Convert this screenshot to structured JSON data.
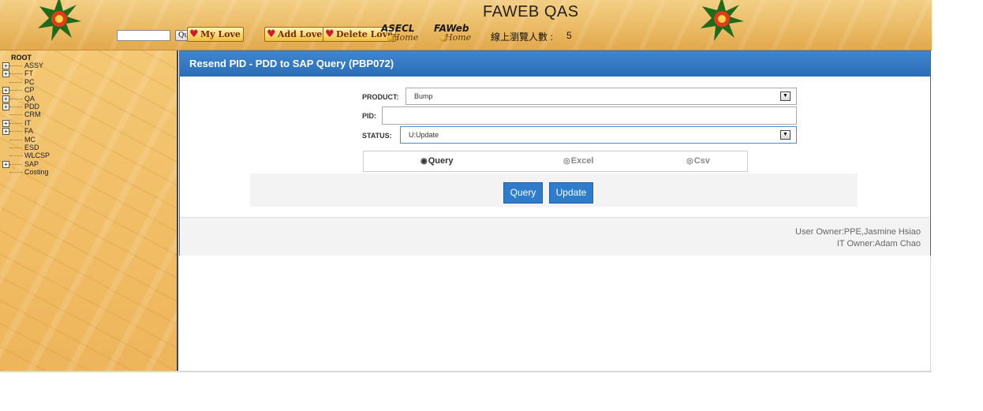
{
  "banner": {
    "site_title": "FAWEB QAS",
    "search_value": "",
    "query_button": "Query",
    "my_love_button": "My Love",
    "add_love_button": "Add Love",
    "delete_love_button": "Delete Love",
    "asecl_home": {
      "top": "ASECL",
      "sub": "Home"
    },
    "faweb_home": {
      "top": "FAWeb",
      "sub": "Home"
    },
    "online_label": "線上瀏覽人數 :",
    "online_count": "5"
  },
  "sidebar": {
    "root": "ROOT",
    "items": [
      {
        "label": "ASSY",
        "expandable": true
      },
      {
        "label": "FT",
        "expandable": true
      },
      {
        "label": "PC",
        "expandable": false
      },
      {
        "label": "CP",
        "expandable": true
      },
      {
        "label": "QA",
        "expandable": true
      },
      {
        "label": "PDD",
        "expandable": true
      },
      {
        "label": "CRM",
        "expandable": false
      },
      {
        "label": "IT",
        "expandable": true
      },
      {
        "label": "FA",
        "expandable": true
      },
      {
        "label": "MC",
        "expandable": false
      },
      {
        "label": "ESD",
        "expandable": false
      },
      {
        "label": "WLCSP",
        "expandable": false
      },
      {
        "label": "SAP",
        "expandable": true
      },
      {
        "label": "Costing",
        "expandable": false
      }
    ],
    "expand_glyph": "+"
  },
  "panel": {
    "title": "Resend PID - PDD to SAP Query (PBP072)",
    "product": {
      "label": "PRODUCT:",
      "value": "Bump"
    },
    "pid": {
      "label": "PID:",
      "value": ""
    },
    "status": {
      "label": "STATUS:",
      "value": "U:Update"
    },
    "output_options": [
      {
        "label": "Query",
        "selected": true
      },
      {
        "label": "Excel",
        "selected": false
      },
      {
        "label": "Csv",
        "selected": false
      }
    ],
    "query_button": "Query",
    "update_button": "Update",
    "user_owner": "User Owner:PPE,Jasmine Hsiao",
    "it_owner": "IT Owner:Adam Chao"
  },
  "colors": {
    "accent": "#2f7ccc",
    "header_blue": "#2a6db6",
    "banner_gold": "#eab963"
  },
  "icons": {
    "logo": "flower-star-logo",
    "heart": "heart-icon",
    "select_arrow": "chevron-down-icon",
    "radio_on": "radio-selected-icon",
    "radio_off": "radio-empty-icon",
    "expand": "expand-plus-icon"
  }
}
